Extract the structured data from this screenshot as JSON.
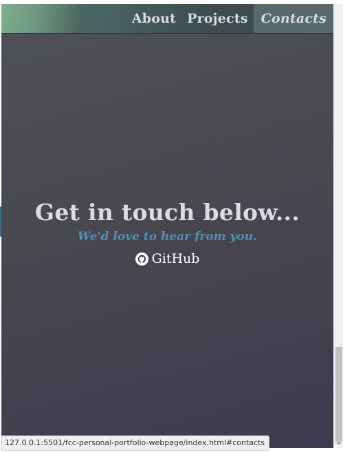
{
  "nav": {
    "links": [
      {
        "label": "About"
      },
      {
        "label": "Projects"
      },
      {
        "label": "Contacts",
        "active": true
      }
    ]
  },
  "contact": {
    "title": "Get in touch below...",
    "subtitle": "We'd love to hear from you.",
    "github_label": "GitHub",
    "github_icon": "github-icon"
  },
  "status_bar": {
    "url": "127.0.0.1:5501/fcc-personal-portfolio-webpage/index.html#contacts"
  },
  "colors": {
    "subtitle": "#4f8fb5",
    "title": "#d9dde1",
    "nav_active_bg": "#57696c"
  }
}
